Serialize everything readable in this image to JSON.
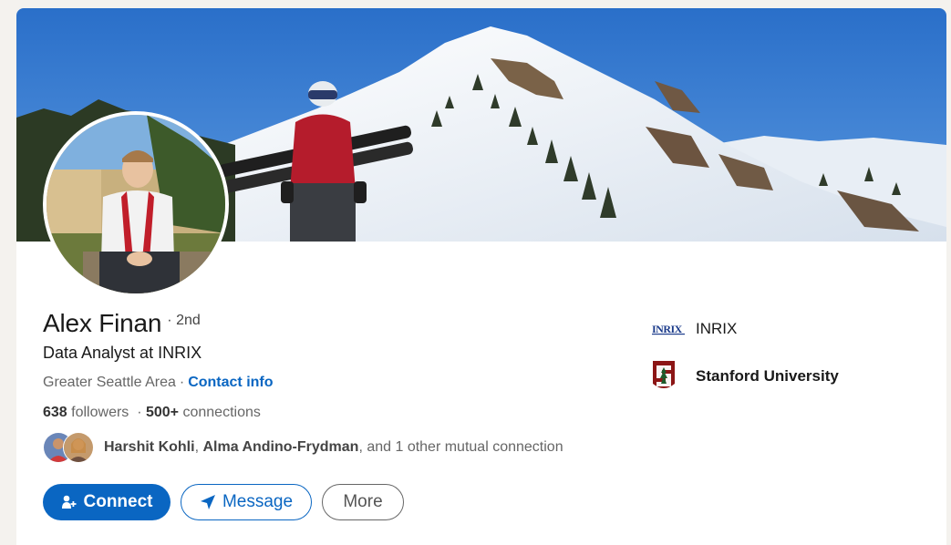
{
  "profile": {
    "name": "Alex Finan",
    "degree": "· 2nd",
    "headline": "Data Analyst at INRIX",
    "location": "Greater Seattle Area",
    "separator": "·",
    "contact_label": "Contact info"
  },
  "stats": {
    "followers_count": "638",
    "followers_label": "followers",
    "connections_prefix": "·",
    "connections_count": "500+",
    "connections_label": "connections"
  },
  "mutual": {
    "person1": "Harshit Kohli",
    "comma": ",",
    "person2": "Alma Andino-Frydman",
    "suffix": ", and 1 other mutual connection"
  },
  "actions": {
    "connect_label": "Connect",
    "message_label": "Message",
    "more_label": "More"
  },
  "orgs": [
    {
      "name": "INRIX",
      "logo_text": "INRIX",
      "icon": "inrix-logo-icon"
    },
    {
      "name": "Stanford University",
      "icon": "stanford-logo-icon"
    }
  ],
  "colors": {
    "accent": "#0a66c2",
    "stanford_red": "#8c1515"
  }
}
